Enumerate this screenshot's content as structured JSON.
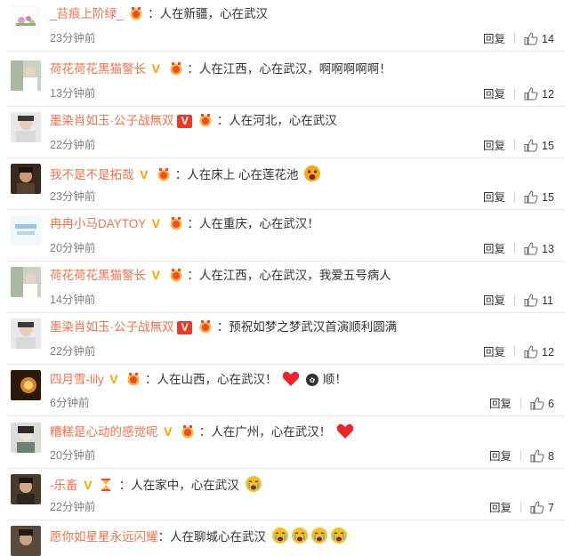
{
  "comments": [
    {
      "user": "_苔痕上阶绿_",
      "vip": "",
      "text": "：人在新疆，心在武汉",
      "time": "23分钟前",
      "reply": "回复",
      "likes": "14",
      "emojis": [],
      "avatar": "flowers"
    },
    {
      "user": "荷花荷花黑猫警长",
      "vip": "gold",
      "text": "：人在江西，心在武汉，啊啊啊啊啊！",
      "time": "13分钟前",
      "reply": "回复",
      "likes": "12",
      "emojis": [],
      "avatar": "girl"
    },
    {
      "user": "墨染肖如玉·公子战無双",
      "vip": "red",
      "text": "：人在河北，心在武汉",
      "time": "22分钟前",
      "reply": "回复",
      "likes": "15",
      "emojis": [],
      "avatar": "man"
    },
    {
      "user": "我不是不是拓哉",
      "vip": "gold",
      "text": "：人在床上 心在莲花池",
      "time": "23分钟前",
      "reply": "回复",
      "likes": "15",
      "emojis": [
        "surprised"
      ],
      "avatar": "dark"
    },
    {
      "user": "冉冉小马DAYTOY",
      "vip": "gold",
      "text": "：人在重庆，心在武汉！",
      "time": "20分钟前",
      "reply": "回复",
      "likes": "13",
      "emojis": [],
      "avatar": "logo"
    },
    {
      "user": "荷花荷花黑猫警长",
      "vip": "gold",
      "text": "：人在江西，心在武汉，我爱五号病人",
      "time": "14分钟前",
      "reply": "回复",
      "likes": "11",
      "emojis": [],
      "avatar": "girl"
    },
    {
      "user": "墨染肖如玉·公子战無双",
      "vip": "red",
      "text": "：预祝如梦之梦武汉首演顺利圆满",
      "time": "22分钟前",
      "reply": "回复",
      "likes": "12",
      "emojis": [],
      "avatar": "man"
    },
    {
      "user": "四月雪-lily",
      "vip": "gold",
      "text": "：人在山西，心在武汉！",
      "text2": "顺！",
      "time": "6分钟前",
      "reply": "回复",
      "likes": "6",
      "emojis": [
        "heart",
        "badge"
      ],
      "avatar": "fire"
    },
    {
      "user": "糟糕是心动的感觉呢",
      "vip": "gold",
      "text": "：人在广州，心在武汉！",
      "time": "20分钟前",
      "reply": "回复",
      "likes": "8",
      "emojis": [
        "heart"
      ],
      "avatar": "woman"
    },
    {
      "user": "-乐畜",
      "vip": "gold",
      "text": "：人在家中，心在武汉",
      "time": "22分钟前",
      "reply": "回复",
      "likes": "7",
      "emojis": [
        "cry"
      ],
      "avatar": "portrait"
    },
    {
      "user": "愿你如星星永远闪耀",
      "vip": "",
      "text": "：人在聊城心在武汉",
      "time": "",
      "reply": "",
      "likes": "",
      "emojis": [
        "cry",
        "cry",
        "cry",
        "cry"
      ],
      "avatar": "portrait2"
    }
  ],
  "colors": {
    "username": "#eb7350",
    "text": "#333333",
    "time": "#808080",
    "vip_gold": "#f7a200",
    "vip_red": "#e73b2c"
  }
}
